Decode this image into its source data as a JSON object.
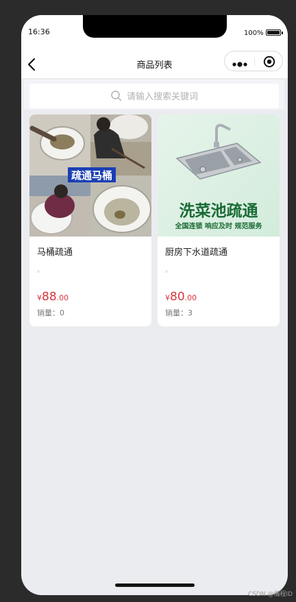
{
  "status_bar": {
    "time": "16:36",
    "battery": "100%"
  },
  "nav": {
    "title": "商品列表"
  },
  "search": {
    "placeholder": "请输入搜索关键词",
    "value": ""
  },
  "products": [
    {
      "name": "马桶疏通",
      "price_symbol": "¥",
      "price_int": "88",
      "price_dec": ".00",
      "sales_label": "销量：",
      "sales": "0",
      "image_text": "疏通马桶"
    },
    {
      "name": "厨房下水道疏通",
      "price_symbol": "¥",
      "price_int": "80",
      "price_dec": ".00",
      "sales_label": "销量：",
      "sales": "3",
      "image_title": "洗菜池疏通",
      "image_subtitle": "全国连锁 响应及时 规范服务"
    }
  ],
  "watermark": "CSDN @编程ID",
  "colors": {
    "price": "#d9363e",
    "background": "#ebecef",
    "card": "#ffffff"
  }
}
